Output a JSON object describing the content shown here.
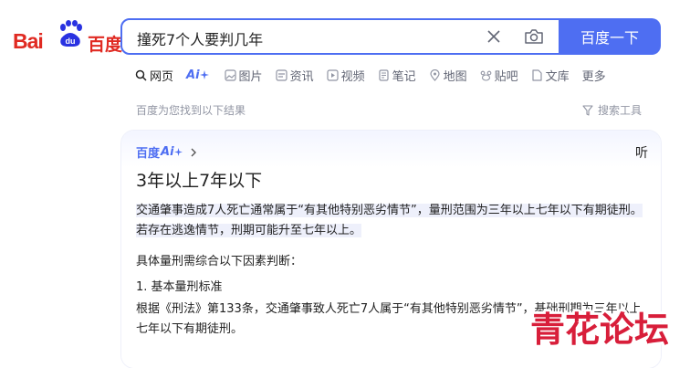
{
  "logo": {
    "bai": "Bai",
    "du": "du",
    "suffix": "百度"
  },
  "search": {
    "query": "撞死7个人要判几年",
    "button_label": "百度一下"
  },
  "tabs": [
    {
      "label": "网页",
      "icon": "search-icon",
      "active": true
    },
    {
      "label": "Ai",
      "icon": "ai-sparkle-icon",
      "active": false
    },
    {
      "label": "图片",
      "icon": "image-icon",
      "active": false
    },
    {
      "label": "资讯",
      "icon": "news-icon",
      "active": false
    },
    {
      "label": "视频",
      "icon": "video-icon",
      "active": false
    },
    {
      "label": "笔记",
      "icon": "note-icon",
      "active": false
    },
    {
      "label": "地图",
      "icon": "map-pin-icon",
      "active": false
    },
    {
      "label": "贴吧",
      "icon": "tieba-icon",
      "active": false
    },
    {
      "label": "文库",
      "icon": "doc-icon",
      "active": false
    },
    {
      "label": "更多",
      "icon": "",
      "active": false
    }
  ],
  "result_count": "百度为您找到以下结果",
  "tools_label": "搜索工具",
  "ai_card": {
    "brand": "百度",
    "ai": "Ai",
    "listen": "听",
    "answer": "3年以上7年以下",
    "paragraph1": "交通肇事造成7人死亡通常属于“有其他特别恶劣情节”，量刑范围为三年以上七年以下有期徒刑。若存在逃逸情节，刑期可能升至七年以上。",
    "paragraph2": "具体量刑需综合以下因素判断：",
    "paragraph3": "1. 基本量刑标准",
    "paragraph4": "根据《刑法》第133条，交通肇事致人死亡7人属于“有其他特别恶劣情节”，基础刑期为三年以上七年以下有期徒刑。"
  },
  "watermark": {
    "text": "青花论坛"
  },
  "colors": {
    "brand_blue": "#4e6ef2",
    "brand_red": "#e02a22",
    "muted_gray": "#9195a3"
  }
}
